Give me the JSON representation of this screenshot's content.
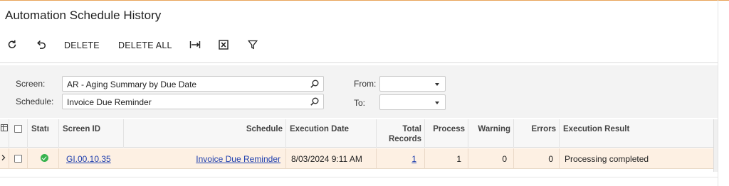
{
  "page": {
    "title": "Automation Schedule History"
  },
  "toolbar": {
    "delete_label": "DELETE",
    "delete_all_label": "DELETE ALL"
  },
  "filters": {
    "screen_label": "Screen:",
    "screen_value": "AR - Aging Summary by Due Date",
    "schedule_label": "Schedule:",
    "schedule_value": "Invoice Due Reminder",
    "from_label": "From:",
    "from_value": "",
    "to_label": "To:",
    "to_value": ""
  },
  "grid": {
    "headers": {
      "status": "Statı",
      "screen_id": "Screen ID",
      "schedule": "Schedule",
      "execution_date": "Execution Date",
      "total_records_1": "Total",
      "total_records_2": "Records",
      "process": "Process",
      "warning": "Warning",
      "errors": "Errors",
      "execution_result": "Execution Result"
    },
    "rows": [
      {
        "status": "ok",
        "screen_id": "GI.00.10.35",
        "schedule": "Invoice Due Reminder",
        "execution_date": "8/03/2024 9:11 AM",
        "total_records": "1",
        "process": "1",
        "warning": "0",
        "errors": "0",
        "execution_result": "Processing completed"
      }
    ]
  },
  "colors": {
    "accent_line": "#e9a55a",
    "selected_row": "#fdf0e3",
    "link": "#1f3fae",
    "success": "#37b24d"
  }
}
